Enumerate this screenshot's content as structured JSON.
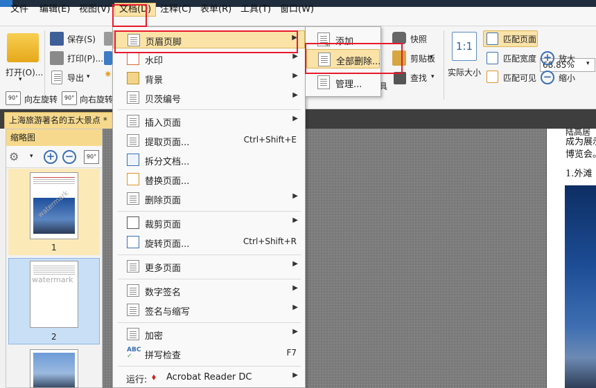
{
  "menubar": {
    "items": [
      "文件",
      "编辑(E)",
      "视图(V)",
      "文档(D)",
      "注释(C)",
      "表单(R)",
      "工具(T)",
      "窗口(W)"
    ]
  },
  "ribbon": {
    "open": "打开(O)...",
    "save": "保存(S)",
    "print": "打印(P)...",
    "export": "导出",
    "rotate_left": "向左旋转",
    "rotate_right": "向右旋转",
    "snapshot": "快照",
    "clipboard": "剪贴板",
    "find": "查找",
    "actual_size": "实际大小",
    "fit_page": "匹配页面",
    "fit_width": "匹配宽度",
    "fit_visible": "匹配可见",
    "zoom_value": "68.85%",
    "zoom_in": "放大",
    "zoom_out": "缩小",
    "partial_label": "具",
    "one_to_one": "1:1"
  },
  "document_tab": {
    "title": "上海旅游著名的五大景点 *"
  },
  "thumbnails": {
    "header": "缩略图",
    "pages": [
      "1",
      "2"
    ],
    "watermark": "watermark"
  },
  "page_content": {
    "line1": "陆高居",
    "line2": "成为展示",
    "line3": "博览会。",
    "heading": "1.外滩"
  },
  "document_menu": {
    "items": [
      {
        "label": "页眉页脚",
        "shortcut": "",
        "submenu": true
      },
      {
        "label": "水印",
        "shortcut": "",
        "submenu": true
      },
      {
        "label": "背景",
        "shortcut": "",
        "submenu": true
      },
      {
        "label": "贝茨编号",
        "shortcut": "",
        "submenu": true
      },
      {
        "label": "插入页面",
        "shortcut": "",
        "submenu": true
      },
      {
        "label": "提取页面...",
        "shortcut": "Ctrl+Shift+E",
        "submenu": false
      },
      {
        "label": "拆分文档...",
        "shortcut": "",
        "submenu": false
      },
      {
        "label": "替换页面...",
        "shortcut": "",
        "submenu": false
      },
      {
        "label": "删除页面",
        "shortcut": "",
        "submenu": true
      },
      {
        "label": "裁剪页面",
        "shortcut": "",
        "submenu": true
      },
      {
        "label": "旋转页面...",
        "shortcut": "Ctrl+Shift+R",
        "submenu": false
      },
      {
        "label": "更多页面",
        "shortcut": "",
        "submenu": true
      },
      {
        "label": "数字签名",
        "shortcut": "",
        "submenu": true
      },
      {
        "label": "签名与缩写",
        "shortcut": "",
        "submenu": true
      },
      {
        "label": "加密",
        "shortcut": "",
        "submenu": true
      },
      {
        "label": "拼写检查",
        "shortcut": "F7",
        "submenu": false
      },
      {
        "label": "运行:",
        "shortcut": "",
        "submenu": true
      }
    ],
    "run_app": "Acrobat Reader DC"
  },
  "header_footer_submenu": {
    "items": [
      "添加",
      "全部删除...",
      "管理..."
    ]
  },
  "colors": {
    "highlight": "#fbe3a8",
    "annotation_red": "#e8192c",
    "tab_yellow": "#f6d98c"
  }
}
